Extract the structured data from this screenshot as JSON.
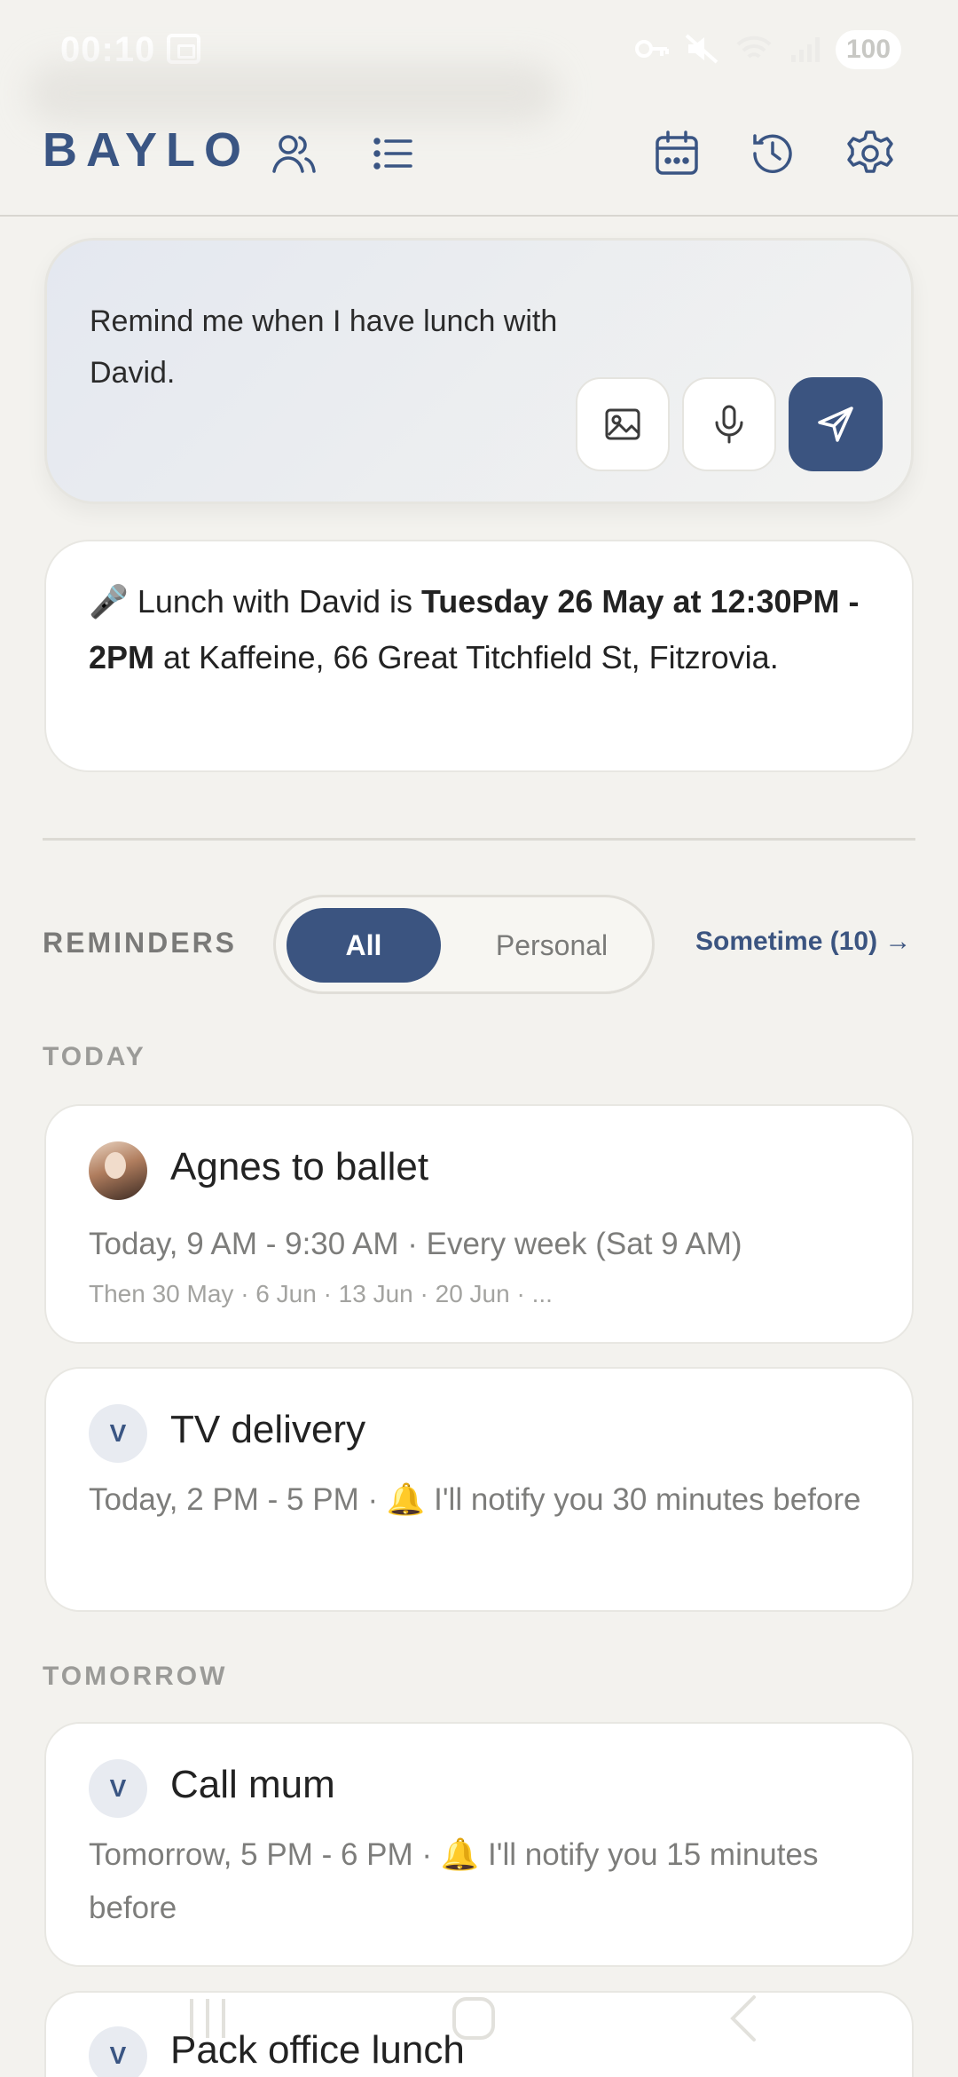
{
  "status_bar": {
    "time": "00:10",
    "battery": "100"
  },
  "header": {
    "logo": "BAYLO",
    "icons": [
      "people-icon",
      "list-icon",
      "calendar-icon",
      "history-icon",
      "settings-icon"
    ]
  },
  "composer": {
    "text": "Remind me when I have lunch with David.",
    "buttons": [
      "image-icon",
      "microphone-icon",
      "send-icon"
    ]
  },
  "answer": {
    "prefix": "🎤 Lunch with David is ",
    "bold": "Tuesday 26 May at 12:30PM - 2PM",
    "suffix": " at Kaffeine, 66 Great Titchfield St, Fitzrovia."
  },
  "reminders": {
    "label": "REMINDERS",
    "filters": [
      "All",
      "Personal"
    ],
    "active_filter": "All",
    "sometime_link": "Sometime (10) →"
  },
  "sections": {
    "today": "TODAY",
    "tomorrow": "TOMORROW"
  },
  "cards": [
    {
      "title": "Agnes to ballet",
      "subtitle": "Today, 9 AM - 9:30 AM · Every week (Sat 9 AM)",
      "detail": "Then 30 May · 6 Jun · 13 Jun · 20 Jun · ...",
      "avatar": ""
    },
    {
      "title": "TV delivery",
      "subtitle": "Today, 2 PM - 5 PM · 🔔 I'll notify you 30 minutes before",
      "avatar": "V"
    },
    {
      "title": "Call mum",
      "subtitle": "Tomorrow, 5 PM - 6 PM · 🔔 I'll notify you 15 minutes before",
      "avatar": "V"
    },
    {
      "title": "Pack office lunch",
      "avatar": "V"
    }
  ],
  "colors": {
    "accent": "#3b5480",
    "background": "#f3f2ee",
    "card": "#ffffff"
  }
}
